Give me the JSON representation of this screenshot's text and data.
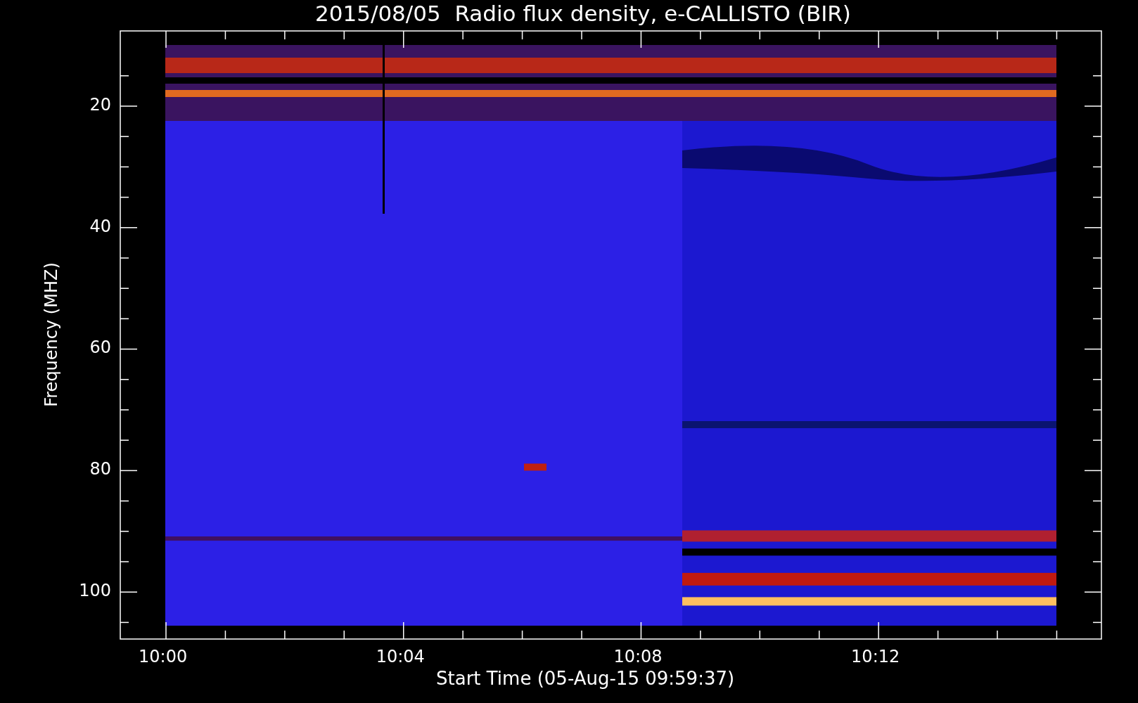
{
  "title": "2015/08/05  Radio flux density, e-CALLISTO (BIR)",
  "y_axis": {
    "label": "Frequency (MHZ)",
    "ticks": [
      "20",
      "40",
      "60",
      "80",
      "100"
    ]
  },
  "x_axis": {
    "label": "Start Time (05-Aug-15 09:59:37)",
    "ticks": [
      "10:00",
      "10:04",
      "10:08",
      "10:12"
    ]
  }
}
